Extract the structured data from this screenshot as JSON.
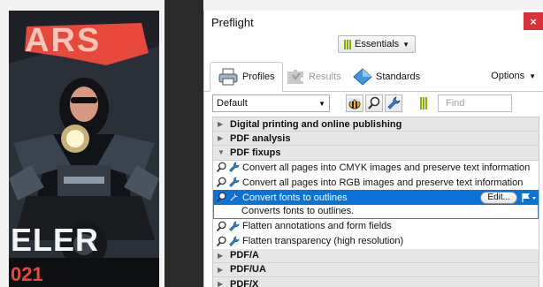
{
  "window": {
    "title": "Preflight",
    "close_glyph": "×"
  },
  "essentials": {
    "label": "Essentials"
  },
  "tabs": [
    {
      "label": "Profiles",
      "icon": "printer-icon",
      "active": true
    },
    {
      "label": "Results",
      "icon": "puzzle-icon",
      "active": false
    },
    {
      "label": "Standards",
      "icon": "diamond-icon",
      "active": false
    }
  ],
  "options": {
    "label": "Options"
  },
  "profile_select": {
    "value": "Default"
  },
  "find": {
    "placeholder": "Find"
  },
  "tree": {
    "groups_top": [
      {
        "label": "Digital printing and online publishing",
        "expanded": false
      },
      {
        "label": "PDF analysis",
        "expanded": false
      },
      {
        "label": "PDF fixups",
        "expanded": true
      }
    ],
    "fixups": [
      {
        "label": "Convert all pages into CMYK images and preserve text information"
      },
      {
        "label": "Convert all pages into RGB images and preserve text information"
      },
      {
        "label": "Convert fonts to outlines",
        "selected": true,
        "edit_label": "Edit...",
        "description": "Converts fonts to outlines."
      },
      {
        "label": "Flatten annotations and form fields"
      },
      {
        "label": "Flatten transparency (high resolution)"
      }
    ],
    "groups_bottom": [
      {
        "label": "PDF/A",
        "expanded": false
      },
      {
        "label": "PDF/UA",
        "expanded": false
      },
      {
        "label": "PDF/X",
        "expanded": false
      }
    ]
  },
  "artwork": {
    "top_text": "ARS",
    "bottom_text": "ELER",
    "year_text": "021"
  },
  "colors": {
    "accent": "#0b72d8",
    "close": "#d9303a",
    "essentials_bars": "#88b000"
  }
}
